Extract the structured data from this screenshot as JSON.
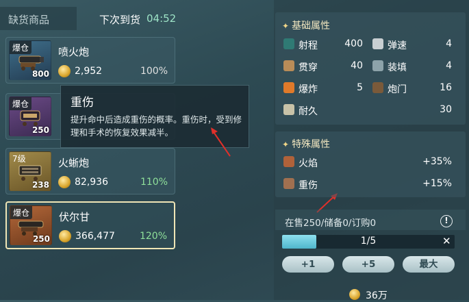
{
  "header": {
    "tab_label": "缺货商品",
    "restock_label": "下次到货",
    "restock_timer": "04:52"
  },
  "items": [
    {
      "tag": "爆仓",
      "qty": "800",
      "name": "喷火炮",
      "price": "2,952",
      "pct": "100%"
    },
    {
      "tag": "爆仓",
      "qty": "250",
      "name": "",
      "price": "",
      "pct": ""
    },
    {
      "tag": "7级",
      "qty": "238",
      "name": "火蜥炮",
      "price": "82,936",
      "pct": "110%"
    },
    {
      "tag": "爆仓",
      "qty": "250",
      "name": "伏尔甘",
      "price": "366,477",
      "pct": "120%"
    }
  ],
  "tooltip": {
    "title": "重伤",
    "body": "提升命中后造成重伤的概率。重伤时，受到修理和手术的恢复效果减半。"
  },
  "base_attrs": {
    "title": "基础属性",
    "stats": [
      {
        "label": "射程",
        "value": "400",
        "icon": "range-icon"
      },
      {
        "label": "弹速",
        "value": "4",
        "icon": "bullet-speed-icon"
      },
      {
        "label": "贯穿",
        "value": "40",
        "icon": "pierce-icon"
      },
      {
        "label": "装填",
        "value": "4",
        "icon": "reload-icon"
      },
      {
        "label": "爆炸",
        "value": "5",
        "icon": "explosion-icon"
      },
      {
        "label": "炮门",
        "value": "16",
        "icon": "gunport-icon"
      },
      {
        "label": "耐久",
        "value": "30",
        "icon": "durability-icon"
      }
    ]
  },
  "special_attrs": {
    "title": "特殊属性",
    "stats": [
      {
        "label": "火焰",
        "value": "+35%",
        "icon": "flame-icon"
      },
      {
        "label": "重伤",
        "value": "+15%",
        "icon": "grievous-wound-icon"
      }
    ]
  },
  "stock": {
    "text": "在售250/储备0/订购0",
    "progress_label": "1/5",
    "progress_fraction": 0.2
  },
  "buttons": {
    "plus1": "+1",
    "plus5": "+5",
    "max": "最大"
  },
  "total": "36万",
  "colors": {
    "accent_gold": "#f2e7c0",
    "green_pct": "#8fe09a",
    "progress": "#4fb6cc"
  }
}
